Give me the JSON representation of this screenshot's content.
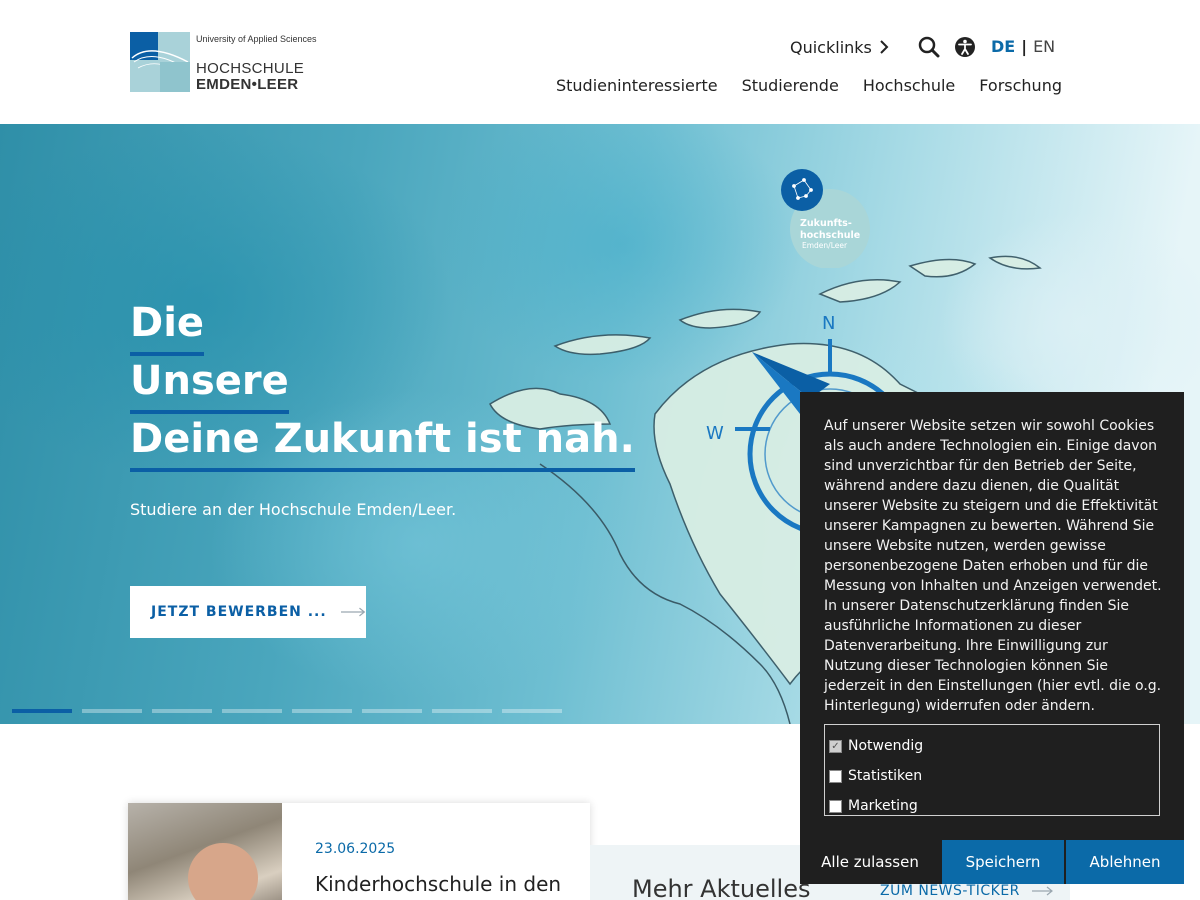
{
  "header": {
    "logo": {
      "tagline": "University of Applied Sciences",
      "line1": "HOCHSCHULE",
      "line2": "EMDEN•LEER"
    },
    "quicklinks_label": "Quicklinks",
    "search_icon": "search-icon",
    "accessibility_icon": "accessibility-icon",
    "lang": {
      "active": "DE",
      "separator": "|",
      "other": "EN"
    },
    "nav": [
      "Studieninteressierte",
      "Studierende",
      "Hochschule",
      "Forschung"
    ]
  },
  "hero": {
    "lines": [
      "Die",
      "Unsere",
      "Deine Zukunft ist nah."
    ],
    "subtitle": "Studiere an der Hochschule Emden/Leer.",
    "cta_label": "JETZT BEWERBEN ...",
    "slides_total": 8,
    "slide_active": 1,
    "badge": {
      "line1": "Zukunfts-",
      "line2": "hochschule",
      "line3": "Emden/Leer"
    },
    "compass": {
      "north": "N",
      "west": "W"
    }
  },
  "news": {
    "date": "23.06.2025",
    "title": "Kinderhochschule in den Sommerferien"
  },
  "more": {
    "title": "Mehr Aktuelles",
    "link": "ZUM NEWS-TICKER"
  },
  "cookie": {
    "text": "Auf unserer Website setzen wir sowohl Cookies als auch andere Technologien ein. Einige davon sind unverzichtbar für den Betrieb der Seite, während andere dazu dienen, die Qualität unserer Website zu steigern und die Effektivität unserer Kampagnen zu bewerten. Während Sie unsere Website nutzen, werden gewisse personenbezogene Daten erhoben und für die Messung von Inhalten und Anzeigen verwendet. In unserer Datenschutzerklärung finden Sie ausführliche Informationen zu dieser Datenverarbeitung. Ihre Einwilligung zur Nutzung dieser Technologien können Sie jederzeit in den Einstellungen (hier evtl. die o.g. Hinterlegung) widerrufen oder ändern.",
    "options": [
      {
        "label": "Notwendig",
        "checked": true,
        "disabled": true
      },
      {
        "label": "Statistiken",
        "checked": false,
        "disabled": false
      },
      {
        "label": "Marketing",
        "checked": false,
        "disabled": false
      }
    ],
    "buttons": {
      "allow": "Alle zulassen",
      "save": "Speichern",
      "deny": "Ablehnen"
    }
  },
  "colors": {
    "brand_blue": "#0b6aa8",
    "dark_panel": "#1f1f1f",
    "hero_teal": "#4aa6bd"
  }
}
